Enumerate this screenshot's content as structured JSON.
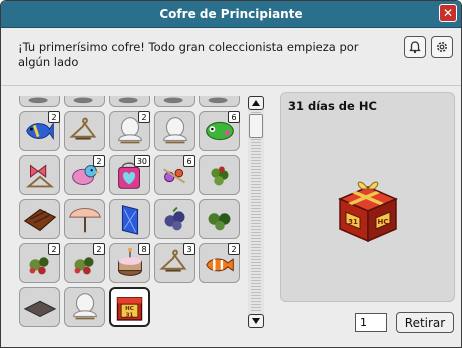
{
  "window": {
    "title": "Cofre de Principiante"
  },
  "header": {
    "description": "¡Tu primerísimo cofre! Todo gran coleccionista empieza por algún lado"
  },
  "inventory": {
    "rows": [
      [
        {
          "icon": "partial-item-icon",
          "count": ""
        },
        {
          "icon": "partial-item-icon",
          "count": ""
        },
        {
          "icon": "partial-item-icon",
          "count": ""
        },
        {
          "icon": "partial-item-icon",
          "count": ""
        },
        {
          "icon": "partial-item-icon",
          "count": ""
        }
      ],
      [
        {
          "icon": "blue-fish-icon",
          "count": "2"
        },
        {
          "icon": "hanger-icon",
          "count": ""
        },
        {
          "icon": "ghost-hanger-icon",
          "count": "2"
        },
        {
          "icon": "ghost-hanger-icon",
          "count": ""
        },
        {
          "icon": "green-creature-icon",
          "count": "6"
        }
      ],
      [
        {
          "icon": "bow-hanger-icon",
          "count": ""
        },
        {
          "icon": "bird-icon",
          "count": "2"
        },
        {
          "icon": "heart-bag-icon",
          "count": "30"
        },
        {
          "icon": "candy-icon",
          "count": "6"
        },
        {
          "icon": "grapes-icon",
          "count": ""
        }
      ],
      [
        {
          "icon": "chocolate-sled-icon",
          "count": ""
        },
        {
          "icon": "umbrella-icon",
          "count": ""
        },
        {
          "icon": "blue-door-icon",
          "count": ""
        },
        {
          "icon": "blueberry-icon",
          "count": ""
        },
        {
          "icon": "green-berries-icon",
          "count": ""
        }
      ],
      [
        {
          "icon": "berries-icon",
          "count": "2"
        },
        {
          "icon": "berries-icon",
          "count": "2"
        },
        {
          "icon": "cake-icon",
          "count": "8"
        },
        {
          "icon": "hanger-icon",
          "count": "3"
        },
        {
          "icon": "clownfish-icon",
          "count": "2"
        }
      ],
      [
        {
          "icon": "dark-rug-icon",
          "count": ""
        },
        {
          "icon": "ghost-hanger-icon",
          "count": ""
        },
        {
          "icon": "hc-gift-icon",
          "count": "",
          "selected": true,
          "label_top": "HC",
          "label_bottom": "31"
        }
      ]
    ]
  },
  "preview": {
    "title": "31 días de HC",
    "gift_label_left": "31",
    "gift_label_right": "HC"
  },
  "footer": {
    "quantity": "1",
    "retire_label": "Retirar"
  },
  "colors": {
    "titlebar": "#2a6f8c",
    "close": "#c8302c",
    "gift_red": "#c42a1a",
    "ribbon": "#e5b93a"
  }
}
